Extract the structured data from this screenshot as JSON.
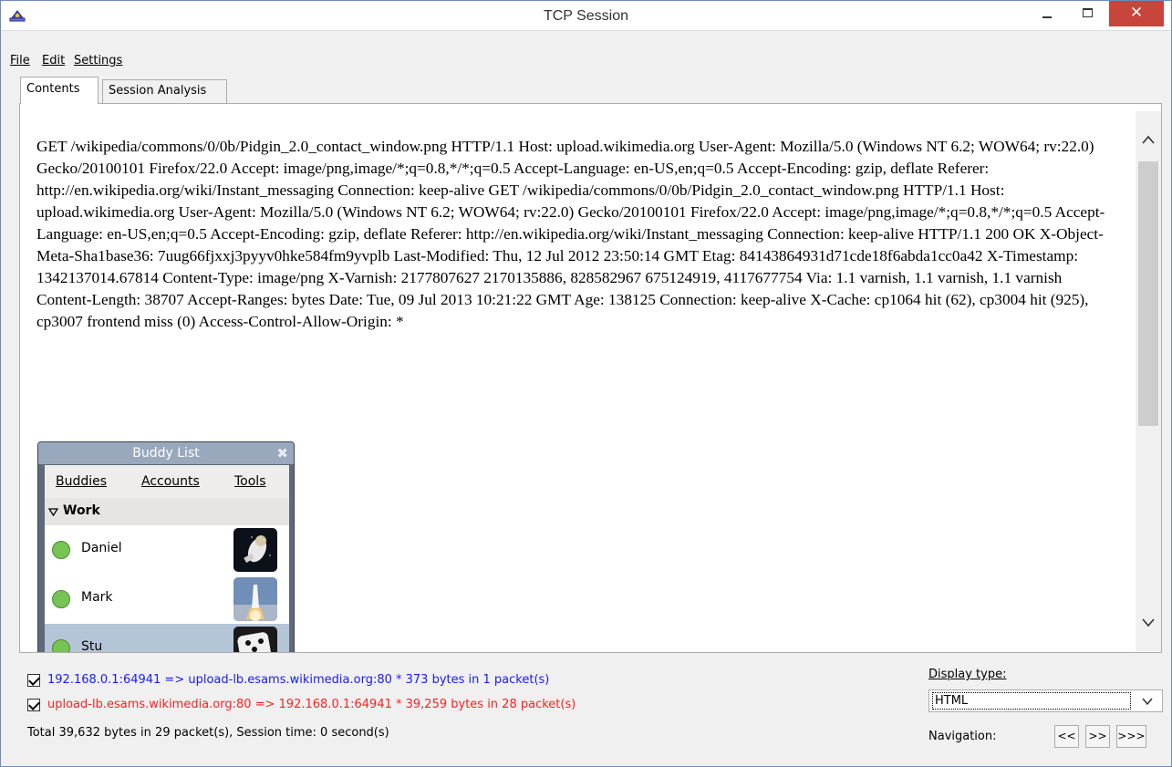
{
  "window": {
    "title": "TCP Session",
    "close_glyph": "✕"
  },
  "menu": {
    "file": "File",
    "edit": "Edit",
    "settings": "Settings"
  },
  "tabs": [
    {
      "label": "Contents",
      "active": true
    },
    {
      "label": "Session Analysis",
      "active": false
    }
  ],
  "content": {
    "http_text": "GET /wikipedia/commons/0/0b/Pidgin_2.0_contact_window.png HTTP/1.1 Host: upload.wikimedia.org User-Agent: Mozilla/5.0 (Windows NT 6.2; WOW64; rv:22.0) Gecko/20100101 Firefox/22.0 Accept: image/png,image/*;q=0.8,*/*;q=0.5 Accept-Language: en-US,en;q=0.5 Accept-Encoding: gzip, deflate Referer: http://en.wikipedia.org/wiki/Instant_messaging Connection: keep-alive GET /wikipedia/commons/0/0b/Pidgin_2.0_contact_window.png HTTP/1.1 Host: upload.wikimedia.org User-Agent: Mozilla/5.0 (Windows NT 6.2; WOW64; rv:22.0) Gecko/20100101 Firefox/22.0 Accept: image/png,image/*;q=0.8,*/*;q=0.5 Accept-Language: en-US,en;q=0.5 Accept-Encoding: gzip, deflate Referer: http://en.wikipedia.org/wiki/Instant_messaging Connection: keep-alive HTTP/1.1 200 OK X-Object-Meta-Sha1base36: 7uug66fjxxj3pyyv0hke584fm9yvplb Last-Modified: Thu, 12 Jul 2012 23:50:14 GMT Etag: 84143864931d71cde18f6abda1cc0a42 X-Timestamp: 1342137014.67814 Content-Type: image/png X-Varnish: 2177807627 2170135886, 828582967 675124919, 4117677754 Via: 1.1 varnish, 1.1 varnish, 1.1 varnish Content-Length: 38707 Accept-Ranges: bytes Date: Tue, 09 Jul 2013 10:21:22 GMT Age: 138125 Connection: keep-alive X-Cache: cp1064 hit (62), cp3004 hit (925), cp3007 frontend miss (0) Access-Control-Allow-Origin: *"
  },
  "buddy_list": {
    "title": "Buddy List",
    "menus": [
      "Buddies",
      "Accounts",
      "Tools"
    ],
    "group": "Work",
    "buddies": [
      {
        "name": "Daniel",
        "status": "available"
      },
      {
        "name": "Mark",
        "status": "available"
      },
      {
        "name": "Stu",
        "status": "available"
      }
    ],
    "colors": {
      "available": "#76c453",
      "selected_row": "#b5c5d8"
    }
  },
  "session": {
    "outbound": {
      "checked": true,
      "label": "192.168.0.1:64941 => upload-lb.esams.wikimedia.org:80 * 373 bytes in 1 packet(s)",
      "color": "#1a1aff"
    },
    "inbound": {
      "checked": true,
      "label": "upload-lb.esams.wikimedia.org:80 => 192.168.0.1:64941 * 39,259 bytes in 28 packet(s)",
      "color": "#ff2020"
    },
    "total": "Total 39,632 bytes in 29 packet(s), Session time: 0 second(s)"
  },
  "display": {
    "label": "Display type:",
    "selected": "HTML"
  },
  "navigation": {
    "label": "Navigation:",
    "buttons": [
      "<<",
      ">>",
      ">>>"
    ]
  }
}
